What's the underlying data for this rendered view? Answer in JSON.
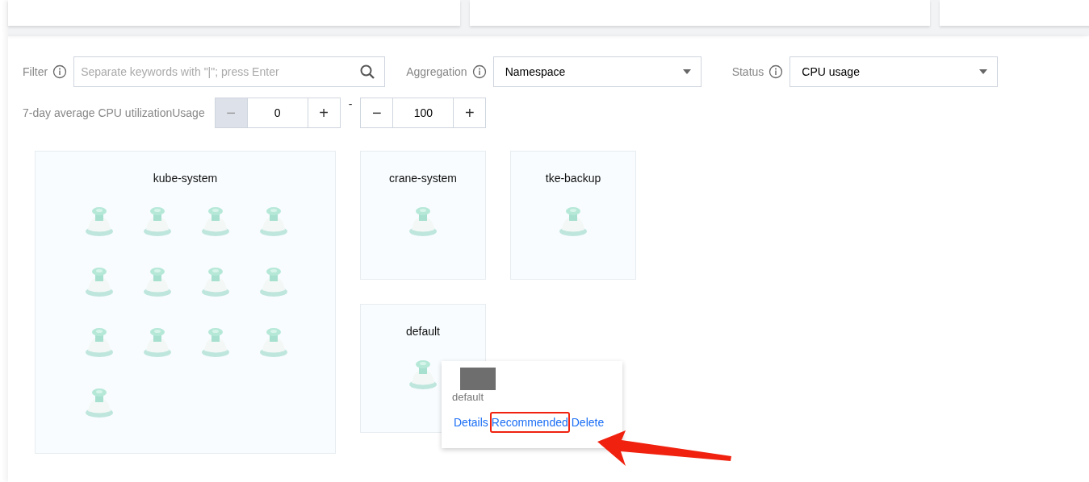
{
  "filters": [
    {
      "kind": "search",
      "label": "Filter",
      "placeholder": "Separate keywords with \"|\"; press Enter"
    },
    {
      "kind": "select",
      "label": "Aggregation",
      "value": "Namespace"
    },
    {
      "kind": "select",
      "label": "Status",
      "value": "CPU usage"
    }
  ],
  "range": {
    "label": "7-day average CPU utilizationUsage",
    "separator": "-",
    "steppers": [
      {
        "minus": "−",
        "value": "0",
        "plus": "+",
        "minus_disabled": true
      },
      {
        "minus": "−",
        "value": "100",
        "plus": "+",
        "minus_disabled": false
      }
    ]
  },
  "namespaces": [
    {
      "name": "kube-system",
      "pods": [
        {
          "kind": "pod"
        },
        {
          "kind": "pod"
        },
        {
          "kind": "pod"
        },
        {
          "kind": "pod"
        },
        {
          "kind": "pod"
        },
        {
          "kind": "pod"
        },
        {
          "kind": "pod"
        },
        {
          "kind": "pod"
        },
        {
          "kind": "pod"
        },
        {
          "kind": "pod"
        },
        {
          "kind": "pod"
        },
        {
          "kind": "pod"
        },
        {
          "kind": "pod"
        }
      ]
    },
    {
      "name": "crane-system",
      "pods": [
        {
          "kind": "pod"
        }
      ]
    },
    {
      "name": "tke-backup",
      "pods": [
        {
          "kind": "pod"
        }
      ]
    },
    {
      "name": "default",
      "pods": [
        {
          "kind": "pod"
        }
      ],
      "popover": {
        "title": "default",
        "actions": [
          {
            "label": "Details",
            "highlighted": false
          },
          {
            "label": "Recommended",
            "highlighted": true
          },
          {
            "label": "Delete",
            "highlighted": false
          }
        ]
      }
    }
  ]
}
